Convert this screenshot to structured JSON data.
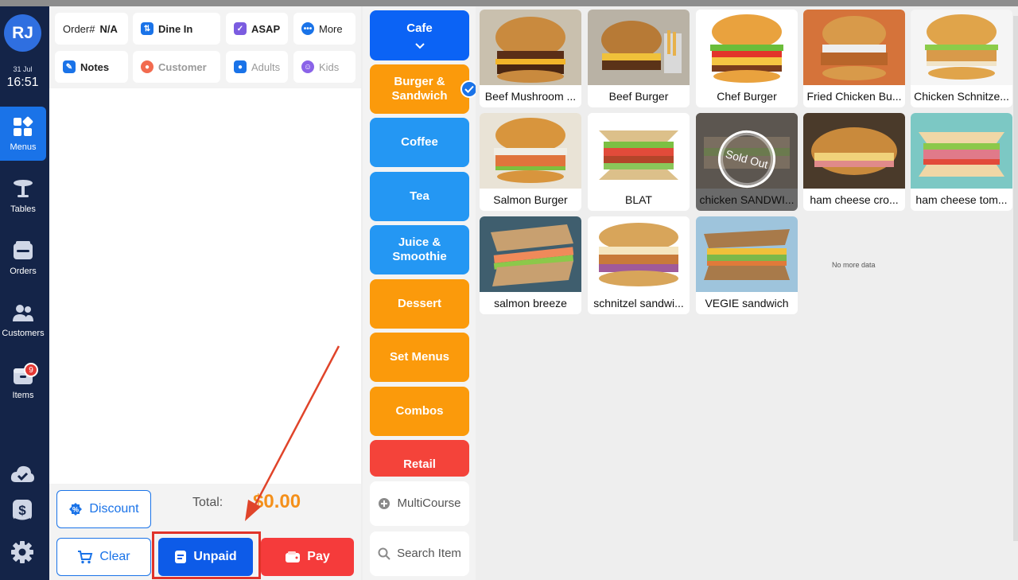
{
  "sidebar": {
    "avatar_initials": "RJ",
    "date": "31 Jul",
    "time": "16:51",
    "items": [
      {
        "label": "Menus",
        "icon": "grid-icon"
      },
      {
        "label": "Tables",
        "icon": "table-icon"
      },
      {
        "label": "Orders",
        "icon": "wallet-icon"
      },
      {
        "label": "Customers",
        "icon": "people-icon"
      },
      {
        "label": "Items",
        "icon": "box-icon",
        "badge": "9"
      }
    ],
    "bottom_icons": [
      "cloud-check-icon",
      "dollar-phone-icon",
      "gear-icon"
    ]
  },
  "order": {
    "order_label": "Order#",
    "order_value": "N/A",
    "dine_in": "Dine In",
    "asap": "ASAP",
    "more": "More",
    "notes": "Notes",
    "customer": "Customer",
    "adults": "Adults",
    "kids": "Kids",
    "discount": "Discount",
    "total_label": "Total:",
    "total_value": "$0.00",
    "clear": "Clear",
    "unpaid": "Unpaid",
    "pay": "Pay"
  },
  "categories": [
    {
      "label": "Cafe",
      "color": "#0b63f5"
    },
    {
      "label": "Burger & Sandwich",
      "color": "#fb9a0b",
      "selected": true
    },
    {
      "label": "Coffee",
      "color": "#2497f3"
    },
    {
      "label": "Tea",
      "color": "#2497f3"
    },
    {
      "label": "Juice & Smoothie",
      "color": "#2497f3"
    },
    {
      "label": "Dessert",
      "color": "#fb9a0b"
    },
    {
      "label": "Set Menus",
      "color": "#fb9a0b"
    },
    {
      "label": "Combos",
      "color": "#fb9a0b"
    },
    {
      "label": "Retail",
      "color": "#f4433a"
    }
  ],
  "category_actions": {
    "multicourse": "MultiCourse",
    "search": "Search Item"
  },
  "items": [
    {
      "name": "Beef Mushroom ..."
    },
    {
      "name": "Beef Burger"
    },
    {
      "name": "Chef Burger"
    },
    {
      "name": "Fried Chicken Bu..."
    },
    {
      "name": "Chicken Schnitze..."
    },
    {
      "name": "Salmon Burger"
    },
    {
      "name": "BLAT"
    },
    {
      "name": "chicken SANDWI...",
      "sold_out": "Sold Out"
    },
    {
      "name": "ham cheese cro..."
    },
    {
      "name": "ham cheese tom..."
    },
    {
      "name": "salmon breeze"
    },
    {
      "name": "schnitzel sandwi..."
    },
    {
      "name": "VEGIE sandwich"
    }
  ],
  "no_more": "No more data",
  "colors": {
    "sidebar": "#142448",
    "accent_blue": "#1a73e8",
    "orange": "#fb9a0b",
    "red": "#f4433a",
    "total": "#f4901b"
  }
}
